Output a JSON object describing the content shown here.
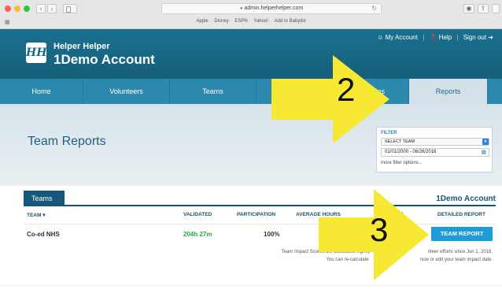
{
  "browser": {
    "url": "admin.helperhelper.com",
    "bookmarks": [
      "Apple",
      "Disney",
      "ESPN",
      "Yahoo!",
      "Add to Babylist"
    ]
  },
  "header": {
    "logo_text": "HH",
    "brand_name": "Helper Helper",
    "account_name": "1Demo Account",
    "my_account": "My Account",
    "help": "Help",
    "sign_out": "Sign out"
  },
  "nav": {
    "items": [
      {
        "label": "Home",
        "active": false
      },
      {
        "label": "Volunteers",
        "active": false
      },
      {
        "label": "Teams",
        "active": false
      },
      {
        "label": "O",
        "active": false
      },
      {
        "label": "ities",
        "active": false
      },
      {
        "label": "Reports",
        "active": true
      }
    ]
  },
  "page": {
    "title": "Team Reports",
    "filter": {
      "label": "FILTER",
      "select_team": "SELECT TEAM",
      "date_range": "01/01/2000 - 06/26/2018",
      "more": "more filter options..."
    },
    "tab_label": "Teams",
    "account_label": "1Demo Account",
    "columns": {
      "team": "TEAM ▾",
      "validated": "VALIDATED",
      "participation": "PARTICIPATION",
      "average_hours": "AVERAGE HOURS",
      "impact_partial": "PE",
      "detailed_report": "DETAILED REPORT"
    },
    "rows": [
      {
        "team": "Co-ed NHS",
        "validated": "204h 27m",
        "participation": "100%",
        "button": "TEAM REPORT"
      }
    ],
    "footnote_line1": "Team Impact Scores are calculated nightly",
    "footnote_line1b": "nteer efforts since Jun 1, 2018.",
    "footnote_line2": "You can re-calculate",
    "footnote_line2b": "now or edit your team impact date."
  },
  "annotations": {
    "arrow_2": "2",
    "arrow_3": "3",
    "color": "#f7e933"
  }
}
